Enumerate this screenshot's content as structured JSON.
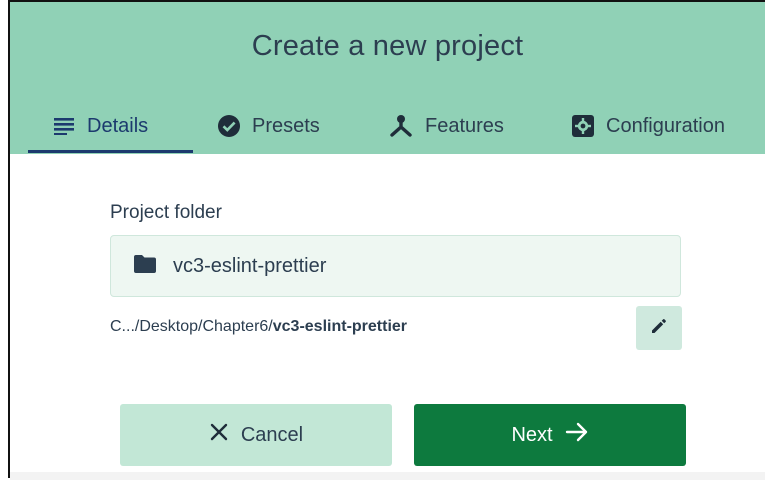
{
  "dialog": {
    "title": "Create a new project"
  },
  "tabs": [
    {
      "label": "Details",
      "icon": "list-icon",
      "active": true
    },
    {
      "label": "Presets",
      "icon": "check-circle-icon",
      "active": false
    },
    {
      "label": "Features",
      "icon": "split-icon",
      "active": false
    },
    {
      "label": "Configuration",
      "icon": "gear-box-icon",
      "active": false
    }
  ],
  "project_folder": {
    "label": "Project folder",
    "folder_name": "vc3-eslint-prettier",
    "path_prefix": "C.../Desktop/Chapter6/",
    "path_current": "vc3-eslint-prettier"
  },
  "actions": {
    "cancel_label": "Cancel",
    "next_label": "Next"
  },
  "colors": {
    "header": "#90d1b6",
    "active_tab": "#1c3a6e",
    "primary": "#0d7a3e",
    "secondary": "#c2e7d6"
  }
}
